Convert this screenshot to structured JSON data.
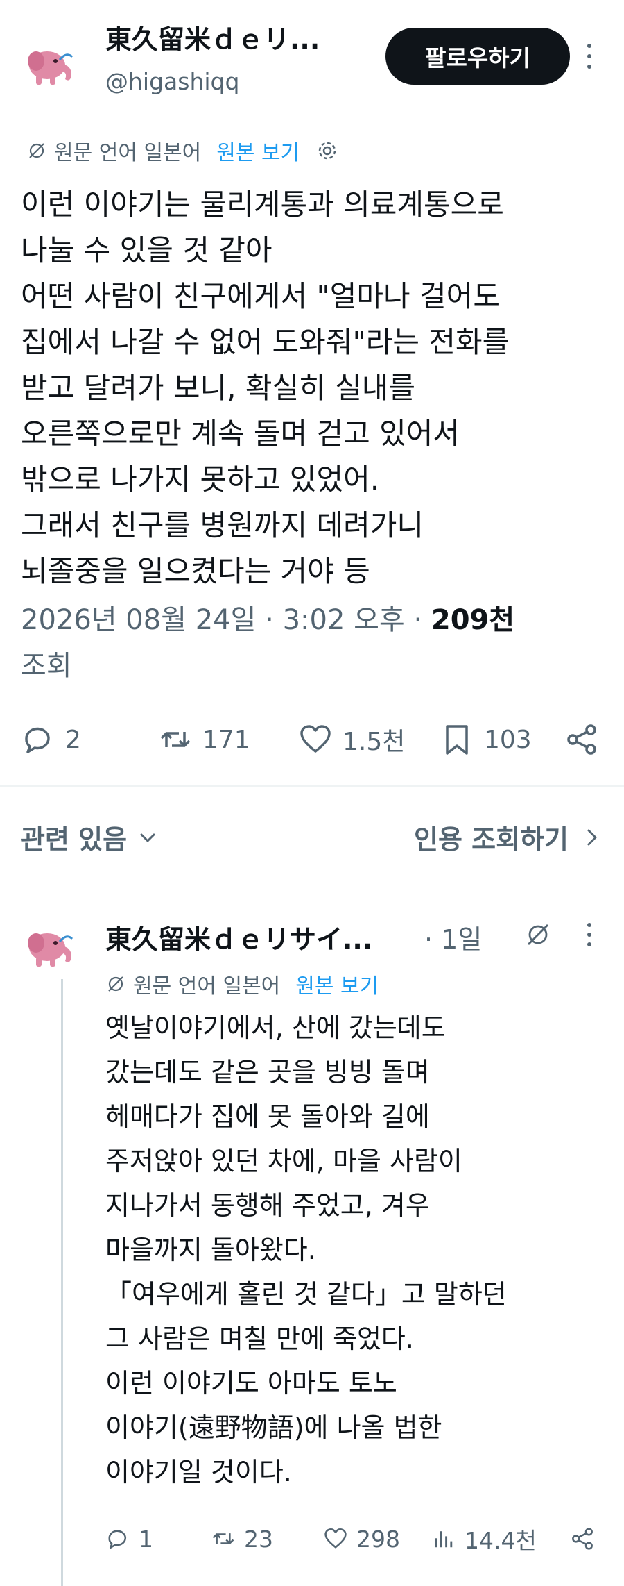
{
  "tweet": {
    "author_name": "東久留米ｄｅリ...",
    "author_handle": "@higashiqq",
    "follow_label": "팔로우하기",
    "translation_note": "원문 언어 일본어",
    "show_original": "원본 보기",
    "body_lines": [
      "이런 이야기는 물리계통과 의료계통으로",
      "나눌 수 있을 것 같아",
      "어떤 사람이 친구에게서 \"얼마나 걸어도",
      "집에서 나갈 수 없어 도와줘\"라는 전화를",
      "받고 달려가 보니, 확실히 실내를",
      "오른쪽으로만 계속 돌며 걷고 있어서",
      "밖으로 나가지 못하고 있었어.",
      "그래서 친구를 병원까지 데려가니",
      "뇌졸중을 일으켰다는 거야 등"
    ],
    "timestamp": "2026년 08월 24일 · 3:02 오후",
    "separator": "·",
    "views_count": "209천",
    "views_label": "조회",
    "replies": "2",
    "retweets": "171",
    "likes": "1.5천",
    "bookmarks": "103"
  },
  "section": {
    "related_label": "관련 있음",
    "quotes_label": "인용 조회하기"
  },
  "reply": {
    "author_name": "東久留米ｄｅリサイ...",
    "time": "· 1일",
    "translation_note": "원문 언어 일본어",
    "show_original": "원본 보기",
    "body_lines": [
      "옛날이야기에서, 산에 갔는데도",
      "갔는데도 같은 곳을 빙빙 돌며",
      "헤매다가 집에 못 돌아와 길에",
      "주저앉아 있던 차에, 마을 사람이",
      "지나가서 동행해 주었고, 겨우",
      "마을까지 돌아왔다.",
      "「여우에게 홀린 것 같다」고 말하던",
      "그 사람은 며칠 만에 죽었다.",
      "이런 이야기도 아마도 토노",
      "이야기(遠野物語)에 나올 법한",
      "이야기일 것이다."
    ],
    "replies": "1",
    "retweets": "23",
    "likes": "298",
    "views": "14.4천"
  },
  "colors": {
    "text": "#0f1419",
    "muted": "#536471",
    "link": "#1d9bf0",
    "avatar_pink": "#e08aa6"
  },
  "icons": [
    "elephant-avatar-icon",
    "more-icon",
    "translate-icon",
    "gear-icon",
    "reply-icon",
    "retweet-icon",
    "like-icon",
    "bookmark-icon",
    "share-icon",
    "chevron-down-icon",
    "chevron-right-icon",
    "views-icon"
  ]
}
